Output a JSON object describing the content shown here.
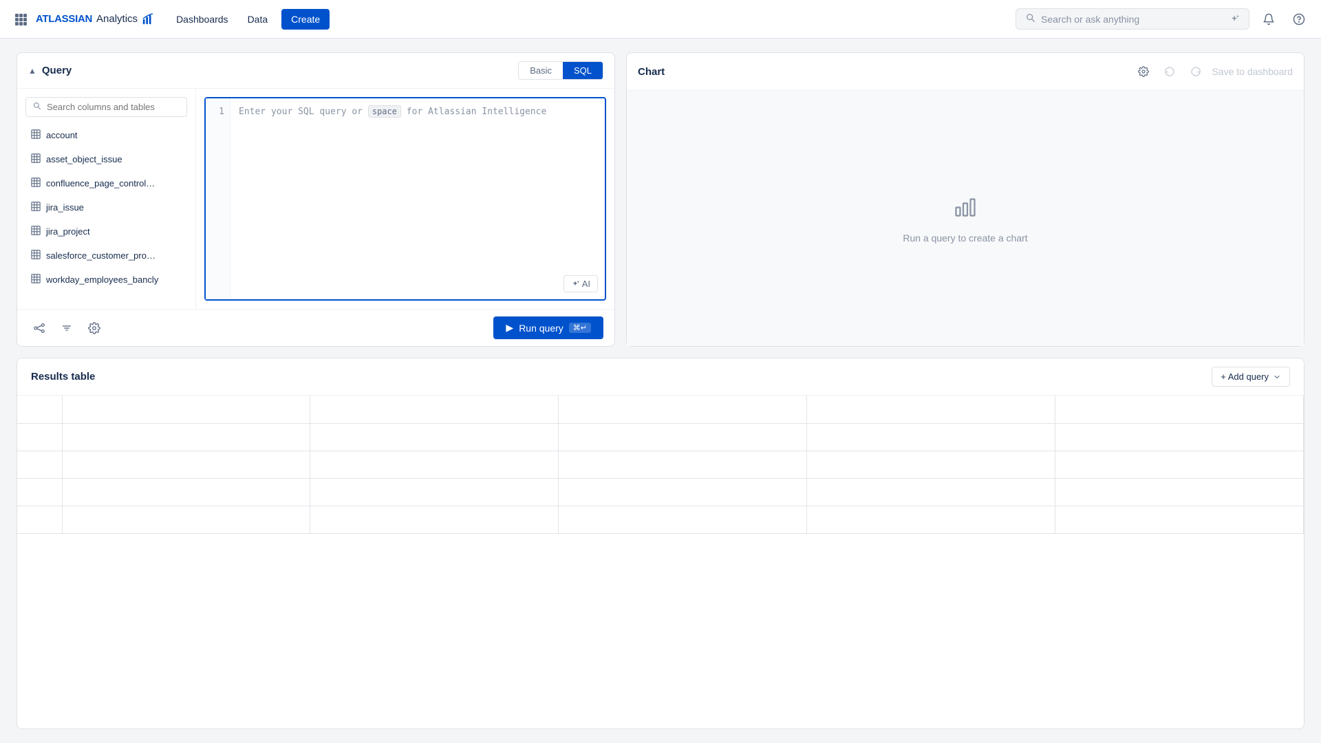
{
  "header": {
    "logo_atlassian": "ATLASSIAN",
    "logo_analytics": "Analytics",
    "nav_dashboards": "Dashboards",
    "nav_data": "Data",
    "nav_create": "Create",
    "search_placeholder": "Search or ask anything",
    "notification_icon": "bell",
    "settings_icon": "question-circle"
  },
  "query": {
    "title": "Query",
    "mode_basic": "Basic",
    "mode_sql": "SQL",
    "active_mode": "SQL",
    "search_placeholder": "Search columns and tables",
    "tables": [
      {
        "name": "account"
      },
      {
        "name": "asset_object_issue"
      },
      {
        "name": "confluence_page_control…"
      },
      {
        "name": "jira_issue"
      },
      {
        "name": "jira_project"
      },
      {
        "name": "salesforce_customer_pro…"
      },
      {
        "name": "workday_employees_bancly"
      }
    ],
    "editor_placeholder_before": "Enter your SQL query or",
    "editor_space_tag": "space",
    "editor_placeholder_after": "for Atlassian Intelligence",
    "ai_button_label": "AI",
    "run_button": "Run query",
    "run_shortcut": "⌘↵",
    "line_number": "1"
  },
  "chart": {
    "title": "Chart",
    "empty_message": "Run a query to create a chart",
    "save_label": "Save to dashboard"
  },
  "results": {
    "title": "Results table",
    "add_query_label": "+ Add query"
  }
}
